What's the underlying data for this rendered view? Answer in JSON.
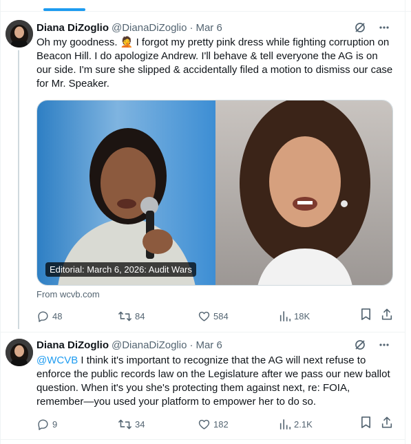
{
  "tweets": [
    {
      "author": {
        "name": "Diana DiZoglio",
        "handle": "@DianaDiZoglio",
        "date": "Mar 6"
      },
      "separator": "·",
      "text": "Oh my goodness. 🤦 I forgot my pretty pink dress while fighting corruption on Beacon Hill. I do apologize Andrew. I'll behave & tell everyone the AG is on our side. I'm sure she slipped & accidentally filed a motion to dismiss our case for Mr. Speaker.",
      "media": {
        "caption": "Editorial: March 6, 2026: Audit Wars"
      },
      "source": "From wcvb.com",
      "stats": {
        "replies": "48",
        "reposts": "84",
        "likes": "584",
        "views": "18K"
      }
    },
    {
      "author": {
        "name": "Diana DiZoglio",
        "handle": "@DianaDiZoglio",
        "date": "Mar 6"
      },
      "separator": "·",
      "mention": "@WCVB",
      "text": " I think it's important to recognize that the AG will next refuse to enforce the public records law on the Legislature after we pass our new ballot question. When it's you she's protecting them against next, re: FOIA, remember—you used your platform to empower her to do so.",
      "stats": {
        "replies": "9",
        "reposts": "34",
        "likes": "182",
        "views": "2.1K"
      }
    }
  ],
  "icons": {
    "hide": "grok-slash-icon",
    "more": "more-dots-icon",
    "reply": "reply-icon",
    "repost": "repost-icon",
    "like": "heart-icon",
    "views": "views-chart-icon",
    "bookmark": "bookmark-icon",
    "share": "share-icon"
  },
  "colors": {
    "accent": "#1d9bf0",
    "secondary_text": "#536471",
    "divider": "#eff3f4"
  }
}
